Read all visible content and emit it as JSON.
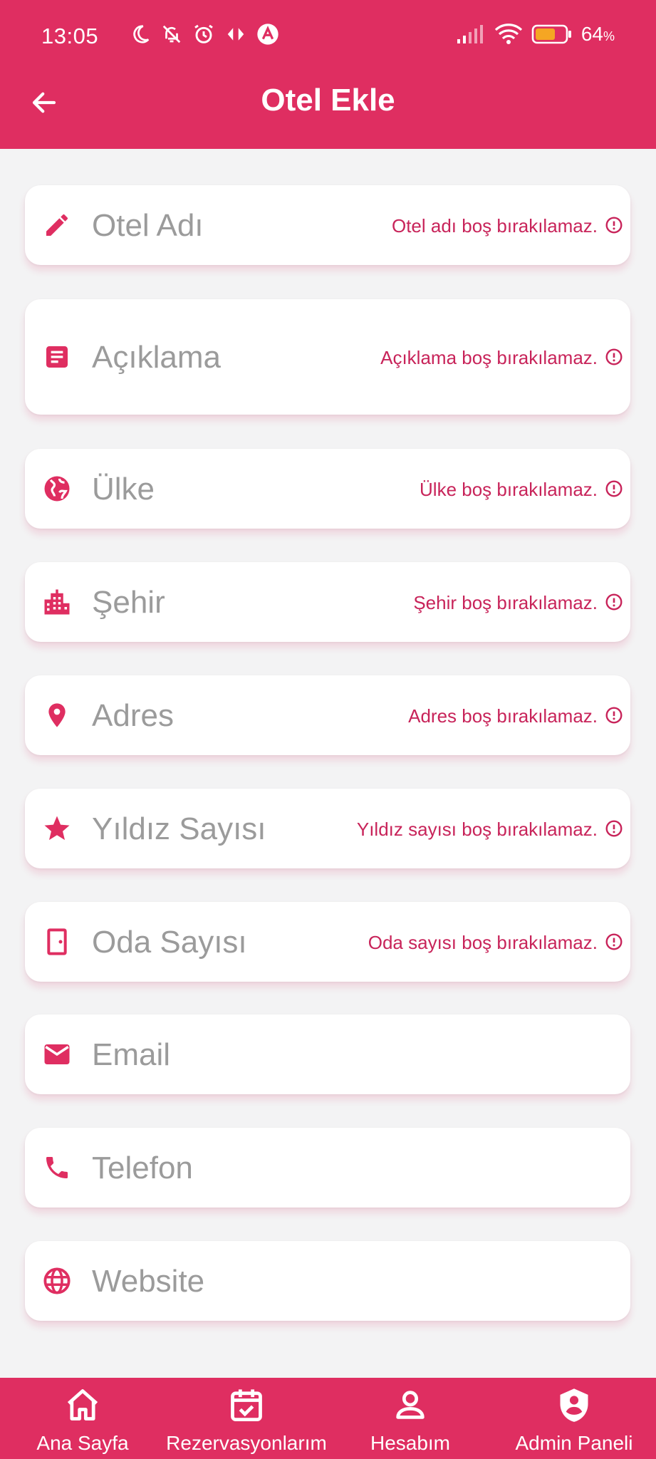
{
  "status_bar": {
    "time": "13:05",
    "battery": "64",
    "battery_unit": "%"
  },
  "appbar": {
    "title": "Otel Ekle"
  },
  "fields": [
    {
      "label": "Otel Adı",
      "icon": "pencil-icon",
      "error": "Otel adı boş bırakılamaz."
    },
    {
      "label": "Açıklama",
      "icon": "description-icon",
      "error": "Açıklama boş bırakılamaz."
    },
    {
      "label": "Ülke",
      "icon": "globe-icon",
      "error": "Ülke boş bırakılamaz."
    },
    {
      "label": "Şehir",
      "icon": "city-icon",
      "error": "Şehir boş bırakılamaz."
    },
    {
      "label": "Adres",
      "icon": "location-pin-icon",
      "error": "Adres boş bırakılamaz."
    },
    {
      "label": "Yıldız Sayısı",
      "icon": "star-icon",
      "error": "Yıldız sayısı boş bırakılamaz."
    },
    {
      "label": "Oda Sayısı",
      "icon": "door-icon",
      "error": "Oda sayısı boş bırakılamaz."
    },
    {
      "label": "Email",
      "icon": "mail-icon",
      "error": ""
    },
    {
      "label": "Telefon",
      "icon": "phone-icon",
      "error": ""
    },
    {
      "label": "Website",
      "icon": "web-icon",
      "error": ""
    }
  ],
  "bottom_nav": [
    {
      "label": "Ana Sayfa",
      "icon": "home-icon"
    },
    {
      "label": "Rezervasyonlarım",
      "icon": "calendar-check-icon"
    },
    {
      "label": "Hesabım",
      "icon": "person-icon"
    },
    {
      "label": "Admin Paneli",
      "icon": "admin-shield-icon"
    }
  ],
  "colors": {
    "primary": "#df2e61",
    "error": "#c8245a",
    "placeholder": "#9b9b9b",
    "background": "#f3f3f4"
  }
}
